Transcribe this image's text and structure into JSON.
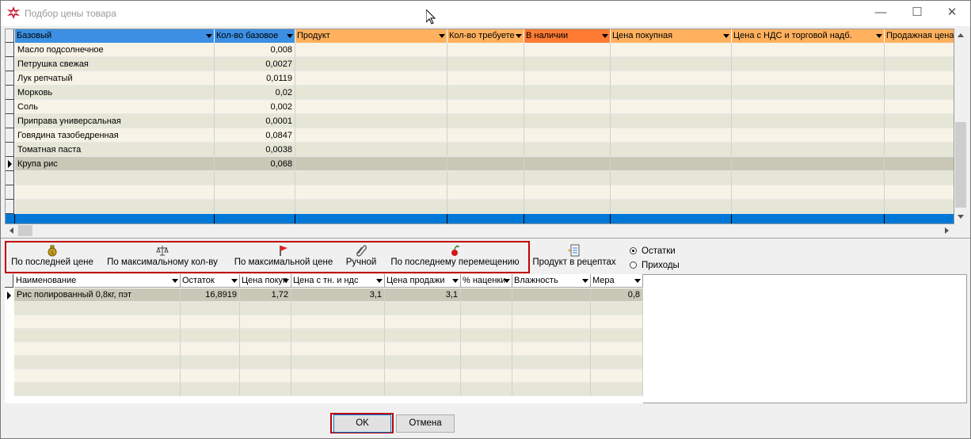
{
  "window": {
    "title": "Подбор цены товара",
    "minimize": "—",
    "maximize": "☐",
    "close": "✕"
  },
  "top_grid": {
    "columns": [
      "Базовый",
      "Кол-во базовое",
      "Продукт",
      "Кол-во требуете",
      "В наличии",
      "Цена покупная",
      "Цена с НДС и торговой надб.",
      "Продажная цена"
    ],
    "rows": [
      {
        "name": "Масло подсолнечное",
        "qty": "0,008"
      },
      {
        "name": "Петрушка свежая",
        "qty": "0,0027"
      },
      {
        "name": "Лук репчатый",
        "qty": "0,0119"
      },
      {
        "name": "Морковь",
        "qty": "0,02"
      },
      {
        "name": "Соль",
        "qty": "0,002"
      },
      {
        "name": "Приправа универсальная",
        "qty": "0,0001"
      },
      {
        "name": "Говядина тазобедренная",
        "qty": "0,0847"
      },
      {
        "name": "Томатная паста",
        "qty": "0,0038"
      },
      {
        "name": "Крупа рис",
        "qty": "0,068"
      }
    ]
  },
  "toolbar": {
    "last_price": "По последней цене",
    "max_qty": "По максимальному кол-ву",
    "max_price": "По максимальной цене",
    "manual": "Ручной",
    "last_move": "По последнему перемещению",
    "product_in_recipes": "Продукт в рецептах"
  },
  "radio": {
    "remainders": "Остатки",
    "arrivals": "Приходы",
    "selected": "Остатки"
  },
  "bottom_grid": {
    "columns": [
      "Наименование",
      "Остаток",
      "Цена покуп",
      "Цена с тн. и ндс",
      "Цена продажи",
      "% наценки",
      "Влажность",
      "Мера"
    ],
    "rows": [
      {
        "name": "Рис полированный 0,8кг, пэт",
        "stock": "16,8919",
        "buy": "1,72",
        "with_vat": "3,1",
        "sale": "3,1",
        "markup": "",
        "humidity": "",
        "measure": "0,8"
      }
    ]
  },
  "buttons": {
    "ok": "OK",
    "cancel": "Отмена"
  },
  "colors": {
    "header_blue": "#3c8fe3",
    "header_orange": "#ffb15e",
    "header_orange_dark": "#ff7a33",
    "row_even": "#f7f3e6",
    "row_odd": "#e5e6d6",
    "row_selected": "#c9c8b7",
    "footer_blue": "#0078d7",
    "highlight_border": "#c00000"
  }
}
